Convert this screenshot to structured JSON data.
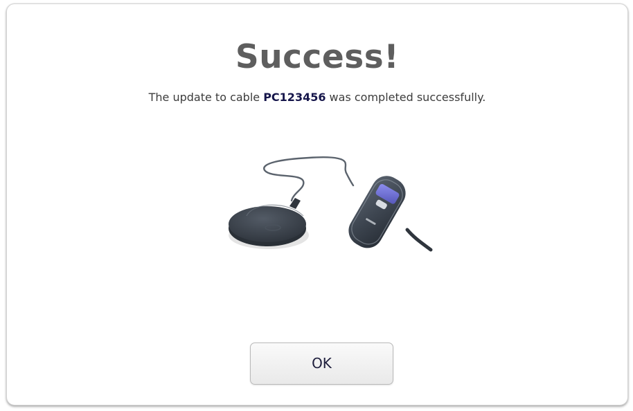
{
  "dialog": {
    "title": "Success!",
    "message_prefix": "The update to cable ",
    "cable_id": "PC123456",
    "message_suffix": " was completed successfully.",
    "ok_label": "OK",
    "device_image": "pump-cable-device-image"
  },
  "colors": {
    "title": "#5e5e5e",
    "message_text": "#3c3c3c",
    "cable_id": "#15154a",
    "device_body": "#3e4651",
    "device_screen": "#6b6ccf"
  }
}
